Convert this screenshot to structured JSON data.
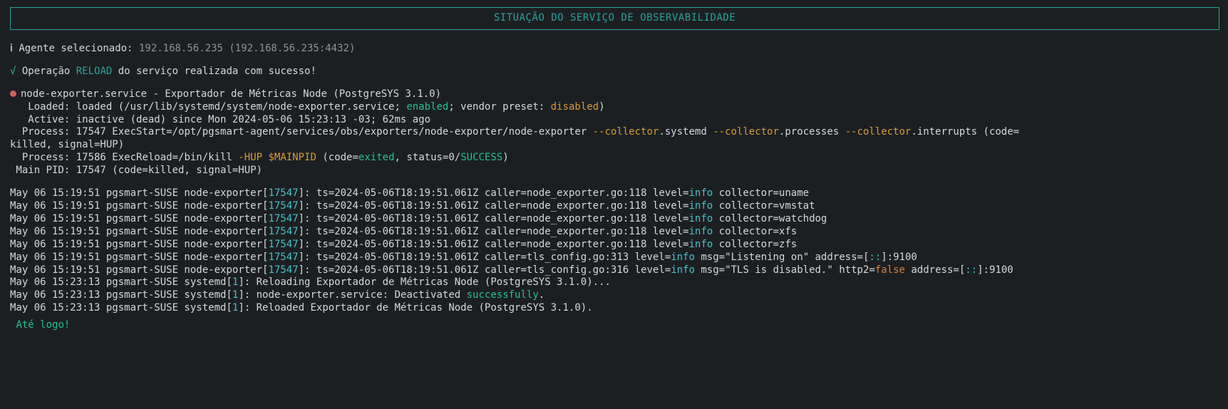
{
  "title": "SITUAÇÃO DO SERVIÇO DE OBSERVABILIDADE",
  "agent": {
    "label": "Agente selecionado:",
    "ip": "192.168.56.235",
    "endpoint": "(192.168.56.235:4432)"
  },
  "success": {
    "prefix": "Operação ",
    "op": "RELOAD",
    "suffix": " do serviço realizada com sucesso!"
  },
  "service": {
    "name": "node-exporter.service",
    "sep": " - ",
    "desc": "Exportador de Métricas Node (PostgreSYS 3.1.0)",
    "loaded_label": "   Loaded: ",
    "loaded_pre": "loaded (/usr/lib/systemd/system/node-exporter.service; ",
    "loaded_enabled": "enabled",
    "loaded_mid": "; vendor preset: ",
    "loaded_disabled": "disabled",
    "loaded_end": ")",
    "active_label": "   Active: ",
    "active_value": "inactive (dead) since Mon 2024-05-06 15:23:13 -03; 62ms ago",
    "process_label": "  Process: ",
    "process_pid": "17547",
    "process_pre": " ExecStart=/opt/pgsmart-agent/services/obs/exporters/node-exporter/node-exporter ",
    "proc_col1": "--collector",
    "proc_dot1": ".systemd ",
    "proc_col2": "--collector",
    "proc_dot2": ".processes ",
    "proc_col3": "--collector",
    "proc_dot3": ".interrupts (code=",
    "process_wrap": "killed, signal=HUP)",
    "process2_label": "  Process: ",
    "process2_pid": "17586",
    "process2_pre": " ExecReload=/bin/kill ",
    "process2_hup": "-HUP ",
    "process2_main": "$MAINPID",
    "process2_mid1": " (code=",
    "process2_exited": "exited",
    "process2_mid2": ", status=0/",
    "process2_success": "SUCCESS",
    "process2_end": ")",
    "mainpid_label": " Main PID: ",
    "mainpid_value": "17547 (code=killed, signal=HUP)"
  },
  "loglines": {
    "ts_host": "May 06 15:19:51 pgsmart-SUSE node-exporter",
    "br_open": "[",
    "pid": "17547",
    "br_close": "]",
    "colon": ": ",
    "rest_pre": "ts=2024-05-06T18:19:51.061Z caller=node_exporter.go:118 level=",
    "info": "info",
    "collectors": [
      " collector=uname",
      " collector=vmstat",
      " collector=watchdog",
      " collector=xfs",
      " collector=zfs"
    ],
    "tls1_pre": "ts=2024-05-06T18:19:51.061Z caller=tls_config.go:313 level=",
    "tls1_mid": " msg=\"Listening on\" address=",
    "tls_addr_open": "[",
    "tls_addr_colons": "::",
    "tls_addr_close": "]",
    "tls_addr_port": ":9100",
    "tls2_pre": "ts=2024-05-06T18:19:51.061Z caller=tls_config.go:316 level=",
    "tls2_mid": " msg=\"TLS is disabled.\" http2=",
    "tls2_false": "false",
    "tls2_addr": " address="
  },
  "syslines": {
    "prefix": "May 06 15:23:13 pgsmart-SUSE systemd",
    "br_open": "[",
    "pid": "1",
    "br_close": "]",
    "colon": ": ",
    "line1": "Reloading Exportador de Métricas Node (PostgreSYS 3.1.0)...",
    "line2a": "node-exporter.service: Deactivated ",
    "line2b": "successfully",
    "line2c": ".",
    "line3": "Reloaded Exportador de Métricas Node (PostgreSYS 3.1.0)."
  },
  "bye": "Até logo!"
}
